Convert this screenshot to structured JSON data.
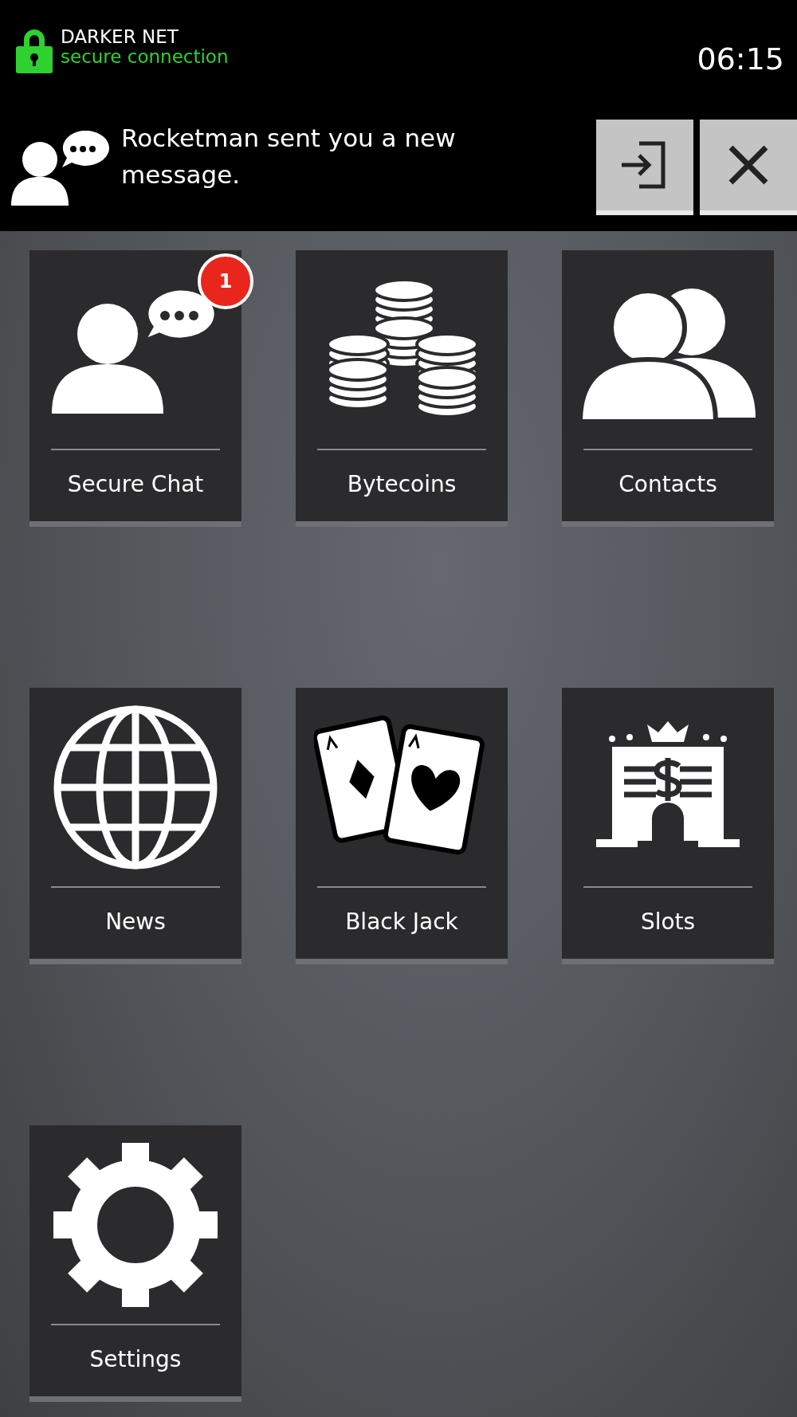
{
  "status_bar": {
    "app_name": "DARKER NET",
    "connection": "secure connection",
    "time": "06:15"
  },
  "notification": {
    "message": "Rocketman sent you a new message."
  },
  "tiles": [
    {
      "label": "Secure Chat",
      "kind": "chat",
      "badge": "1"
    },
    {
      "label": "Bytecoins",
      "kind": "coins"
    },
    {
      "label": "Contacts",
      "kind": "contacts"
    },
    {
      "label": "News",
      "kind": "globe"
    },
    {
      "label": "Black Jack",
      "kind": "cards"
    },
    {
      "label": "Slots",
      "kind": "slots"
    },
    {
      "label": "Settings",
      "kind": "gear"
    }
  ]
}
